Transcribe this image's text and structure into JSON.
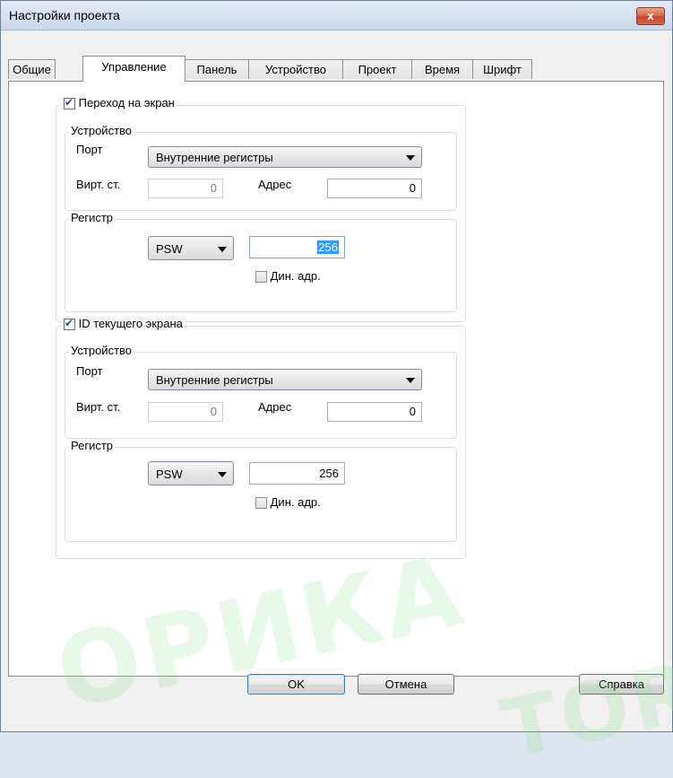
{
  "window": {
    "title": "Настройки проекта",
    "close_label": "x"
  },
  "tabs": [
    {
      "label": "Общие"
    },
    {
      "label": "Управление"
    },
    {
      "label": "Панель"
    },
    {
      "label": "Устройство"
    },
    {
      "label": "Проект"
    },
    {
      "label": "Время"
    },
    {
      "label": "Шрифт"
    }
  ],
  "active_tab": "Управление",
  "sections": [
    {
      "checkbox_label": "Переход на экран",
      "checked": true,
      "device_group": "Устройство",
      "port_label": "Порт",
      "port_value": "Внутренние регистры",
      "virt_label": "Вирт. ст.",
      "virt_value": "0",
      "addr_label": "Адрес",
      "addr_value": "0",
      "register_group": "Регистр",
      "register_type": "PSW",
      "register_value": "256",
      "dyn_label": "Дин. адр.",
      "dyn_checked": false
    },
    {
      "checkbox_label": "ID текущего экрана",
      "checked": true,
      "device_group": "Устройство",
      "port_label": "Порт",
      "port_value": "Внутренние регистры",
      "virt_label": "Вирт. ст.",
      "virt_value": "0",
      "addr_label": "Адрес",
      "addr_value": "0",
      "register_group": "Регистр",
      "register_type": "PSW",
      "register_value": "256",
      "dyn_label": "Дин. адр.",
      "dyn_checked": false
    }
  ],
  "buttons": {
    "ok": "OK",
    "cancel": "Отмена",
    "help": "Справка"
  },
  "watermark": {
    "text1": "ОРИКА",
    "text2": "TOR"
  }
}
